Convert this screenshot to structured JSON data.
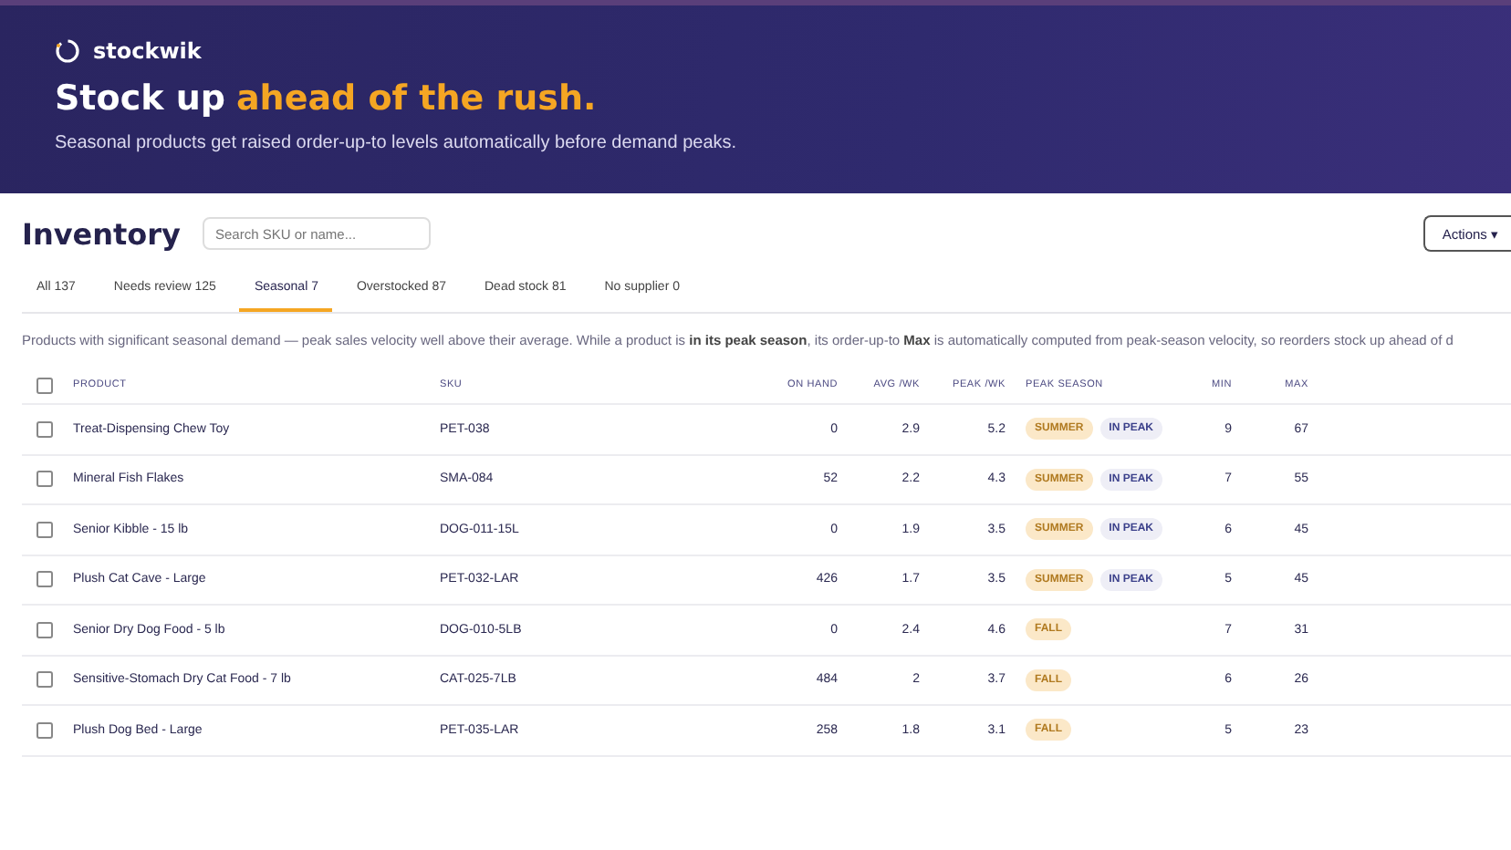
{
  "brand": {
    "name": "stockwik"
  },
  "hero": {
    "title_start": "Stock up",
    "title_highlight": "ahead of the rush.",
    "subtitle": "Seasonal products get raised order-up-to levels automatically before demand peaks."
  },
  "page": {
    "title": "Inventory",
    "search": {
      "placeholder": "Search SKU or name..."
    },
    "actions_button": "Actions ▾"
  },
  "tabs": [
    {
      "label": "All 137",
      "selected": false
    },
    {
      "label": "Needs review 125",
      "selected": false
    },
    {
      "label": "Seasonal 7",
      "selected": true
    },
    {
      "label": "Overstocked 87",
      "selected": false
    },
    {
      "label": "Dead stock 81",
      "selected": false
    },
    {
      "label": "No supplier 0",
      "selected": false
    }
  ],
  "description": "Products with significant seasonal demand — peak sales velocity well above their average. While a product is **in its peak season**, its order-up-to **Max** is automatically computed from peak-season velocity, so reorders stock up ahead of d",
  "table": {
    "select_all_checked": false,
    "columns": [
      "PRODUCT",
      "SKU",
      "ON HAND",
      "AVG /WK",
      "PEAK /WK",
      "PEAK SEASON",
      "MIN",
      "MAX"
    ],
    "rows": [
      {
        "checked": false,
        "product": "Treat-Dispensing Chew Toy",
        "sku": "PET-038",
        "on_hand": "0",
        "avg_wk": "2.9",
        "peak_wk": "5.2",
        "badges": [
          {
            "kind": "season",
            "label": "SUMMER"
          },
          {
            "kind": "status",
            "label": "IN PEAK"
          }
        ],
        "min": "9",
        "max": "67"
      },
      {
        "checked": false,
        "product": "Mineral Fish Flakes",
        "sku": "SMA-084",
        "on_hand": "52",
        "avg_wk": "2.2",
        "peak_wk": "4.3",
        "badges": [
          {
            "kind": "season",
            "label": "SUMMER"
          },
          {
            "kind": "status",
            "label": "IN PEAK"
          }
        ],
        "min": "7",
        "max": "55"
      },
      {
        "checked": false,
        "product": "Senior Kibble - 15 lb",
        "sku": "DOG-011-15L",
        "on_hand": "0",
        "avg_wk": "1.9",
        "peak_wk": "3.5",
        "badges": [
          {
            "kind": "season",
            "label": "SUMMER"
          },
          {
            "kind": "status",
            "label": "IN PEAK"
          }
        ],
        "min": "6",
        "max": "45"
      },
      {
        "checked": false,
        "product": "Plush Cat Cave - Large",
        "sku": "PET-032-LAR",
        "on_hand": "426",
        "avg_wk": "1.7",
        "peak_wk": "3.5",
        "badges": [
          {
            "kind": "season",
            "label": "SUMMER"
          },
          {
            "kind": "status",
            "label": "IN PEAK"
          }
        ],
        "min": "5",
        "max": "45"
      },
      {
        "checked": false,
        "product": "Senior Dry Dog Food - 5 lb",
        "sku": "DOG-010-5LB",
        "on_hand": "0",
        "avg_wk": "2.4",
        "peak_wk": "4.6",
        "badges": [
          {
            "kind": "season",
            "label": "FALL"
          }
        ],
        "min": "7",
        "max": "31"
      },
      {
        "checked": false,
        "product": "Sensitive-Stomach Dry Cat Food - 7 lb",
        "sku": "CAT-025-7LB",
        "on_hand": "484",
        "avg_wk": "2",
        "peak_wk": "3.7",
        "badges": [
          {
            "kind": "season",
            "label": "FALL"
          }
        ],
        "min": "6",
        "max": "26"
      },
      {
        "checked": false,
        "product": "Plush Dog Bed - Large",
        "sku": "PET-035-LAR",
        "on_hand": "258",
        "avg_wk": "1.8",
        "peak_wk": "3.1",
        "badges": [
          {
            "kind": "season",
            "label": "FALL"
          }
        ],
        "min": "5",
        "max": "23"
      }
    ]
  }
}
